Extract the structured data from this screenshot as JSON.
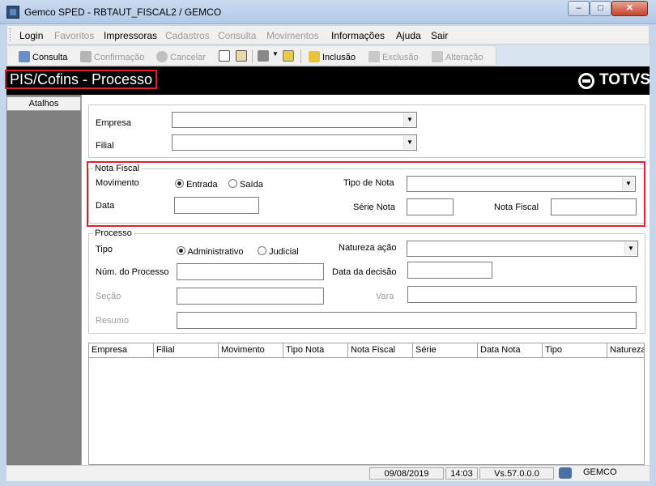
{
  "window": {
    "title": "Gemco SPED - RBTAUT_FISCAL2 / GEMCO",
    "min": "–",
    "max": "□",
    "close": "✕"
  },
  "menu": [
    "Login",
    "Favoritos",
    "Impressoras",
    "Cadastros",
    "Consulta",
    "Movimentos",
    "Informações",
    "Ajuda",
    "Sair"
  ],
  "toolbar": {
    "consulta": "Consulta",
    "confirmacao": "Confirmação",
    "cancelar": "Cancelar",
    "inclusao": "Inclusão",
    "exclusao": "Exclusão",
    "alteracao": "Alteração"
  },
  "header": {
    "title": "PIS/Cofins - Processo",
    "brand": "TOTVS"
  },
  "sidebar": {
    "atalhos": "Atalhos"
  },
  "form": {
    "empresa": "Empresa",
    "filial": "Filial",
    "nota_fiscal_group": "Nota Fiscal",
    "movimento": "Movimento",
    "entrada": "Entrada",
    "saida": "Saída",
    "tipo_nota": "Tipo de Nota",
    "data": "Data",
    "serie_nota": "Série Nota",
    "nota_fiscal": "Nota Fiscal",
    "processo_group": "Processo",
    "tipo": "Tipo",
    "administrativo": "Administrativo",
    "judicial": "Judicial",
    "natureza_acao": "Natureza ação",
    "num_processo": "Núm. do Processo",
    "data_decisao": "Data da decisão",
    "secao": "Seção",
    "vara": "Vara",
    "resumo": "Resumo"
  },
  "table": {
    "columns": [
      "Empresa",
      "Filial",
      "Movimento",
      "Tipo Nota",
      "Nota Fiscal",
      "Série",
      "Data Nota",
      "Tipo",
      "Natureza"
    ]
  },
  "status": {
    "date": "09/08/2019",
    "time": "14:03",
    "version": "Vs.57.0.0.0",
    "user": "GEMCO"
  }
}
